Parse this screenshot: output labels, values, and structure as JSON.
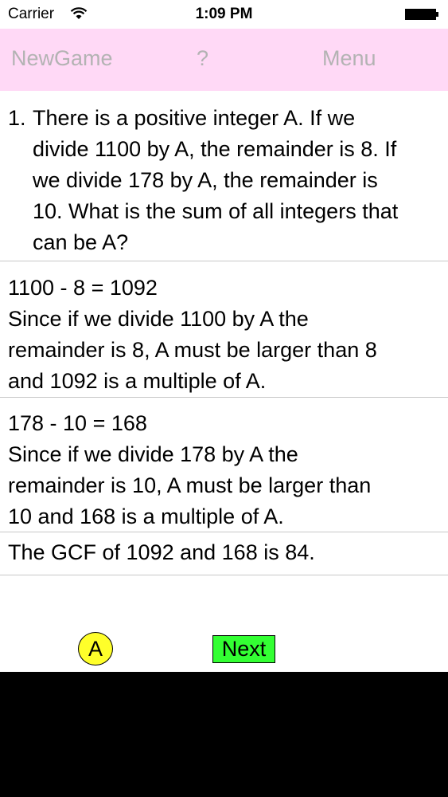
{
  "status_bar": {
    "carrier": "Carrier",
    "time": "1:09 PM"
  },
  "nav": {
    "new_game": "NewGame",
    "help": "?",
    "menu": "Menu"
  },
  "question": {
    "number": "1.",
    "lines": [
      "There is a positive integer A. If we",
      "divide 1100 by A, the remainder is 8. If",
      "we divide 178 by A, the remainder is",
      "10. What is the sum of all integers that",
      "can be A?"
    ]
  },
  "steps": [
    {
      "lines": [
        "1100 - 8 = 1092",
        "Since if we divide 1100 by A the",
        "remainder is 8, A must be larger than 8",
        "and 1092 is a multiple of A."
      ]
    },
    {
      "lines": [
        "178 - 10 = 168",
        "Since if we divide 178 by A the",
        "remainder is 10, A must be larger than",
        "10 and 168 is a multiple of A."
      ]
    },
    {
      "lines": [
        "The GCF of 1092 and 168 is 84."
      ]
    }
  ],
  "controls": {
    "answer_label": "A",
    "next_label": "Next"
  },
  "colors": {
    "nav_background": "#ffd9f6",
    "answer_button": "#ffff2a",
    "next_button": "#33ff33"
  }
}
